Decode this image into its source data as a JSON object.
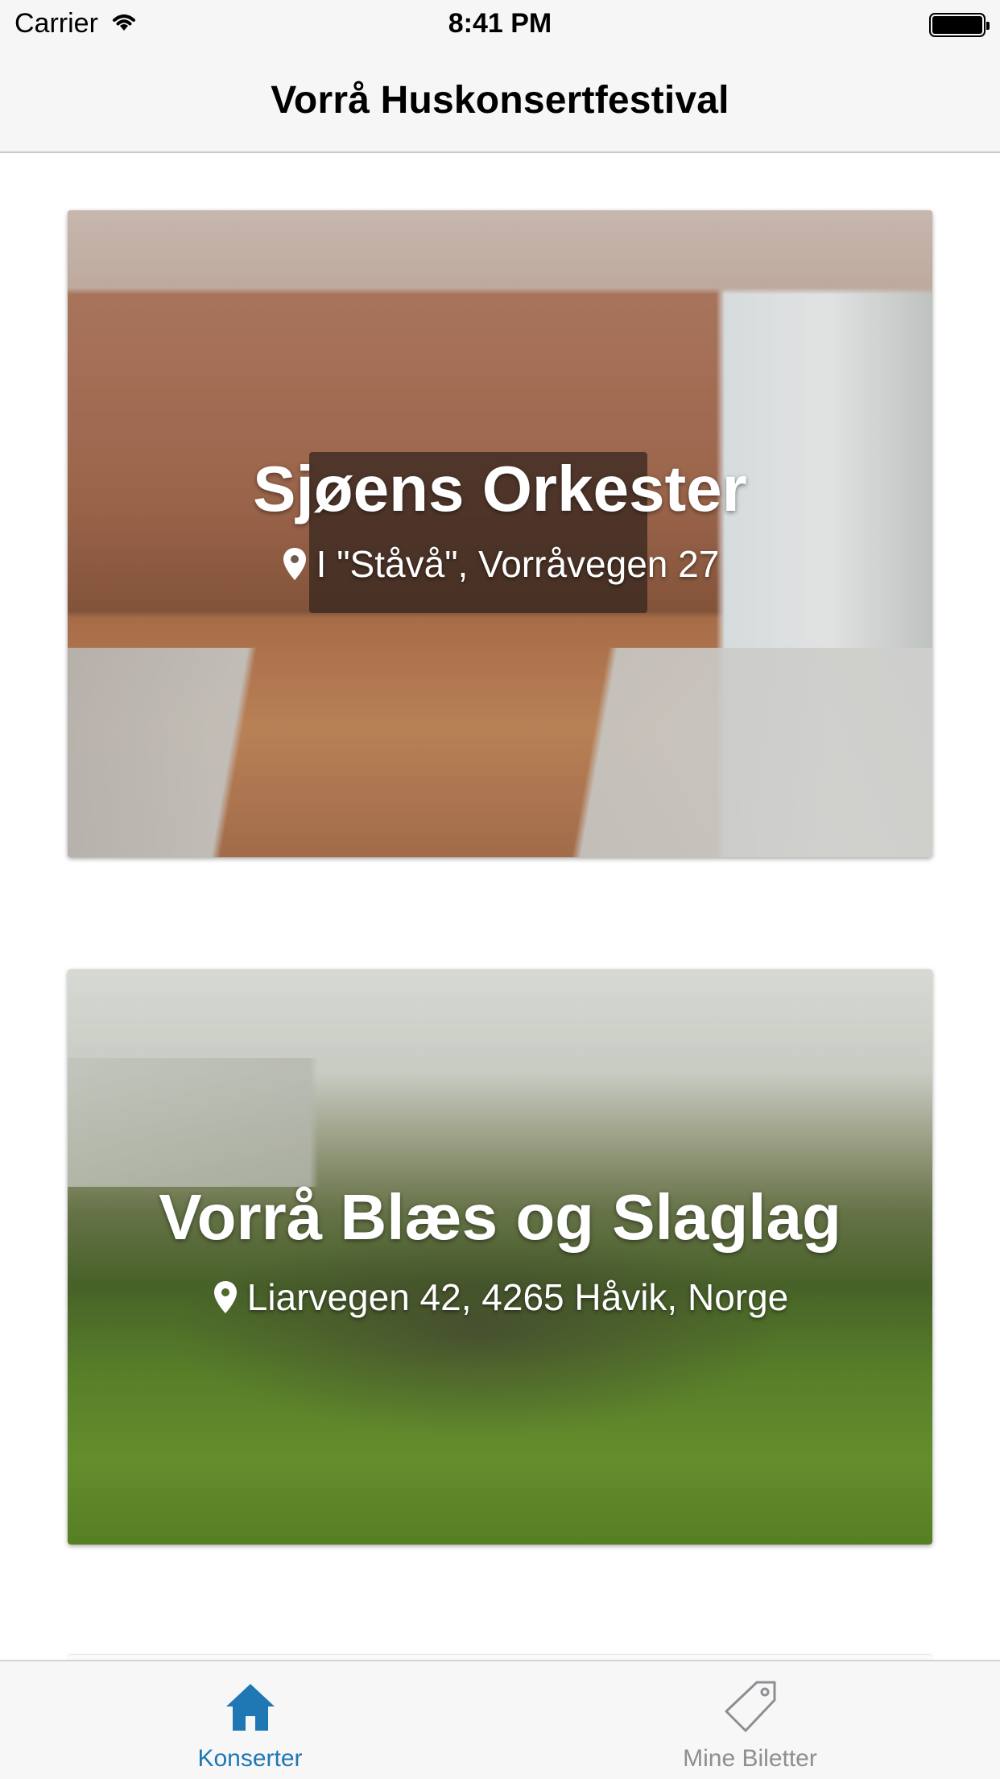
{
  "status_bar": {
    "carrier": "Carrier",
    "time": "8:41 PM",
    "icons": [
      "wifi-icon",
      "battery-icon"
    ]
  },
  "nav": {
    "title": "Vorrå Huskonsertfestival"
  },
  "concerts": [
    {
      "title": "Sjøens Orkester",
      "address": "I \"Ståvå\", Vorråvegen 27",
      "icon": "location-pin-icon"
    },
    {
      "title": "Vorrå Blæs og Slaglag",
      "address": "Liarvegen 42, 4265 Håvik, Norge",
      "icon": "location-pin-icon"
    }
  ],
  "tabs": [
    {
      "label": "Konserter",
      "icon": "home-icon",
      "active": true
    },
    {
      "label": "Mine Biletter",
      "icon": "tag-icon",
      "active": false
    }
  ],
  "colors": {
    "accent": "#1f77b4",
    "inactive": "#8e8e93",
    "bar_background": "#f6f6f6"
  }
}
